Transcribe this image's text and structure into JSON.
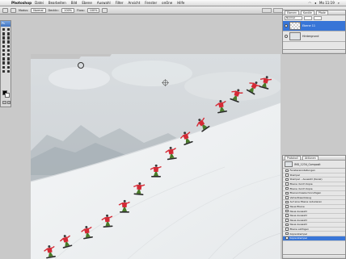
{
  "menubar": {
    "apple_icon": "apple-icon",
    "app_name": "Photoshop",
    "items": [
      "Datei",
      "Bearbeiten",
      "Bild",
      "Ebene",
      "Auswahl",
      "Filter",
      "Ansicht",
      "Fenster",
      "onOne",
      "Hilfe"
    ],
    "clock": "Mo 11:19"
  },
  "options": {
    "size_label": "Modus:",
    "mode_value": "Normal",
    "opacity_label": "Deckkr.:",
    "opacity_value": "100%",
    "flow_label": "Fluss:",
    "flow_value": "100%"
  },
  "toolbox": {
    "title": "Ps"
  },
  "layers": {
    "tabs": [
      "Ebenen",
      "Kanäle",
      "Pfade"
    ],
    "mode": "Normal",
    "rows": [
      {
        "name": "Ebene 11",
        "active": true
      },
      {
        "name": "Hintergrund",
        "active": false
      }
    ]
  },
  "history": {
    "tabs": [
      "Protokoll",
      "Aktionen"
    ],
    "snapshot": "IMG_1234_Composit",
    "rows": [
      {
        "name": "Fenstereinstellungen",
        "active": false
      },
      {
        "name": "Stempel",
        "active": false
      },
      {
        "name": "Stempel – Auswahl (Kanal)",
        "active": false
      },
      {
        "name": "Ebene durch Kopie",
        "active": false
      },
      {
        "name": "Ebene durch Kopie",
        "active": false
      },
      {
        "name": "Ebenenmaske hinzufügen",
        "active": false
      },
      {
        "name": "Verlaufswerkzeug",
        "active": false
      },
      {
        "name": "Auf eine Ebene reduzieren",
        "active": false
      },
      {
        "name": "Neue Ebene",
        "active": false
      },
      {
        "name": "Neue Auswahl",
        "active": false
      },
      {
        "name": "Neue Auswahl",
        "active": false
      },
      {
        "name": "Neue Auswahl",
        "active": false
      },
      {
        "name": "Neue Auswahl",
        "active": false
      },
      {
        "name": "Ebene einfügen",
        "active": false
      },
      {
        "name": "Kopierstempel",
        "active": false
      },
      {
        "name": "Kopierstempel",
        "active": true
      }
    ]
  },
  "colors": {
    "highlight": "#3875d7",
    "jacket": "#d42a35",
    "pants": "#4a7a2a",
    "snow": "#eef1f2"
  }
}
